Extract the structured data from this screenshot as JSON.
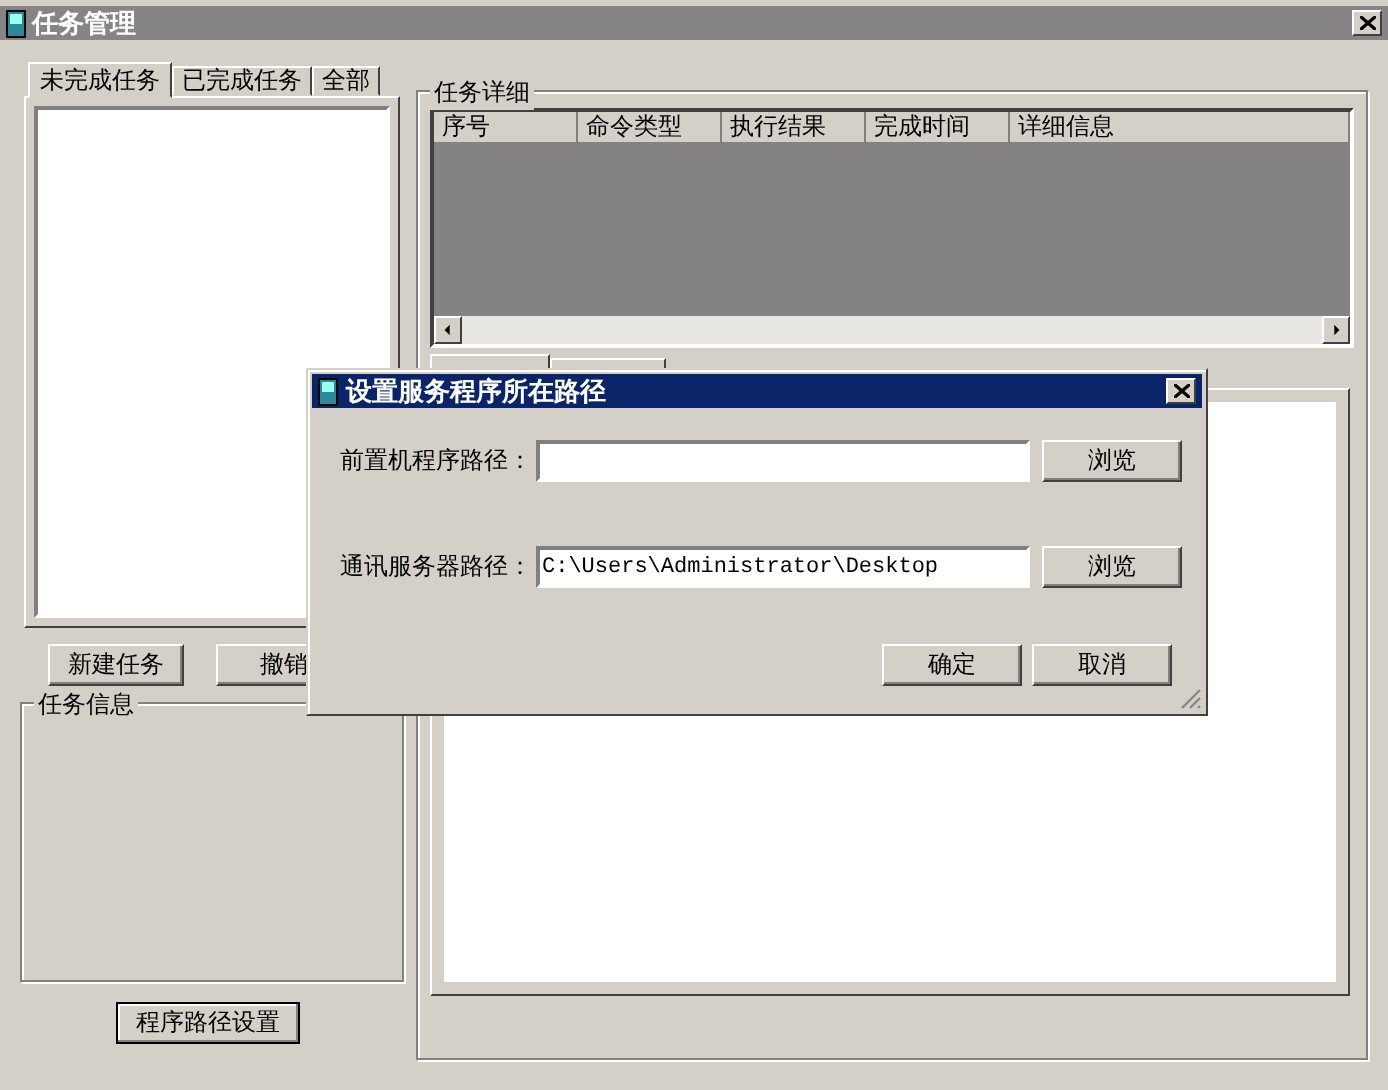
{
  "window": {
    "title": "任务管理"
  },
  "task_tabs": [
    {
      "label": "未完成任务",
      "selected": true
    },
    {
      "label": "已完成任务",
      "selected": false
    },
    {
      "label": "全部",
      "selected": false
    }
  ],
  "task_buttons": [
    "新建任务",
    "撤销"
  ],
  "task_info": {
    "title": "任务信息"
  },
  "path_button": "程序路径设置",
  "details": {
    "title": "任务详细",
    "columns": [
      "序号",
      "命令类型",
      "执行结果",
      "完成时间",
      "详细信息"
    ]
  },
  "detail_tabs": [
    {
      "selected": true
    },
    {
      "selected": false
    }
  ],
  "dialog": {
    "title": "设置服务程序所在路径",
    "rows": [
      {
        "label": "前置机程序路径：",
        "value": "",
        "button": "浏览"
      },
      {
        "label": "通讯服务器路径：",
        "value": "C:\\Users\\Administrator\\Desktop",
        "button": "浏览"
      }
    ],
    "buttons": [
      "确定",
      "取消"
    ]
  }
}
